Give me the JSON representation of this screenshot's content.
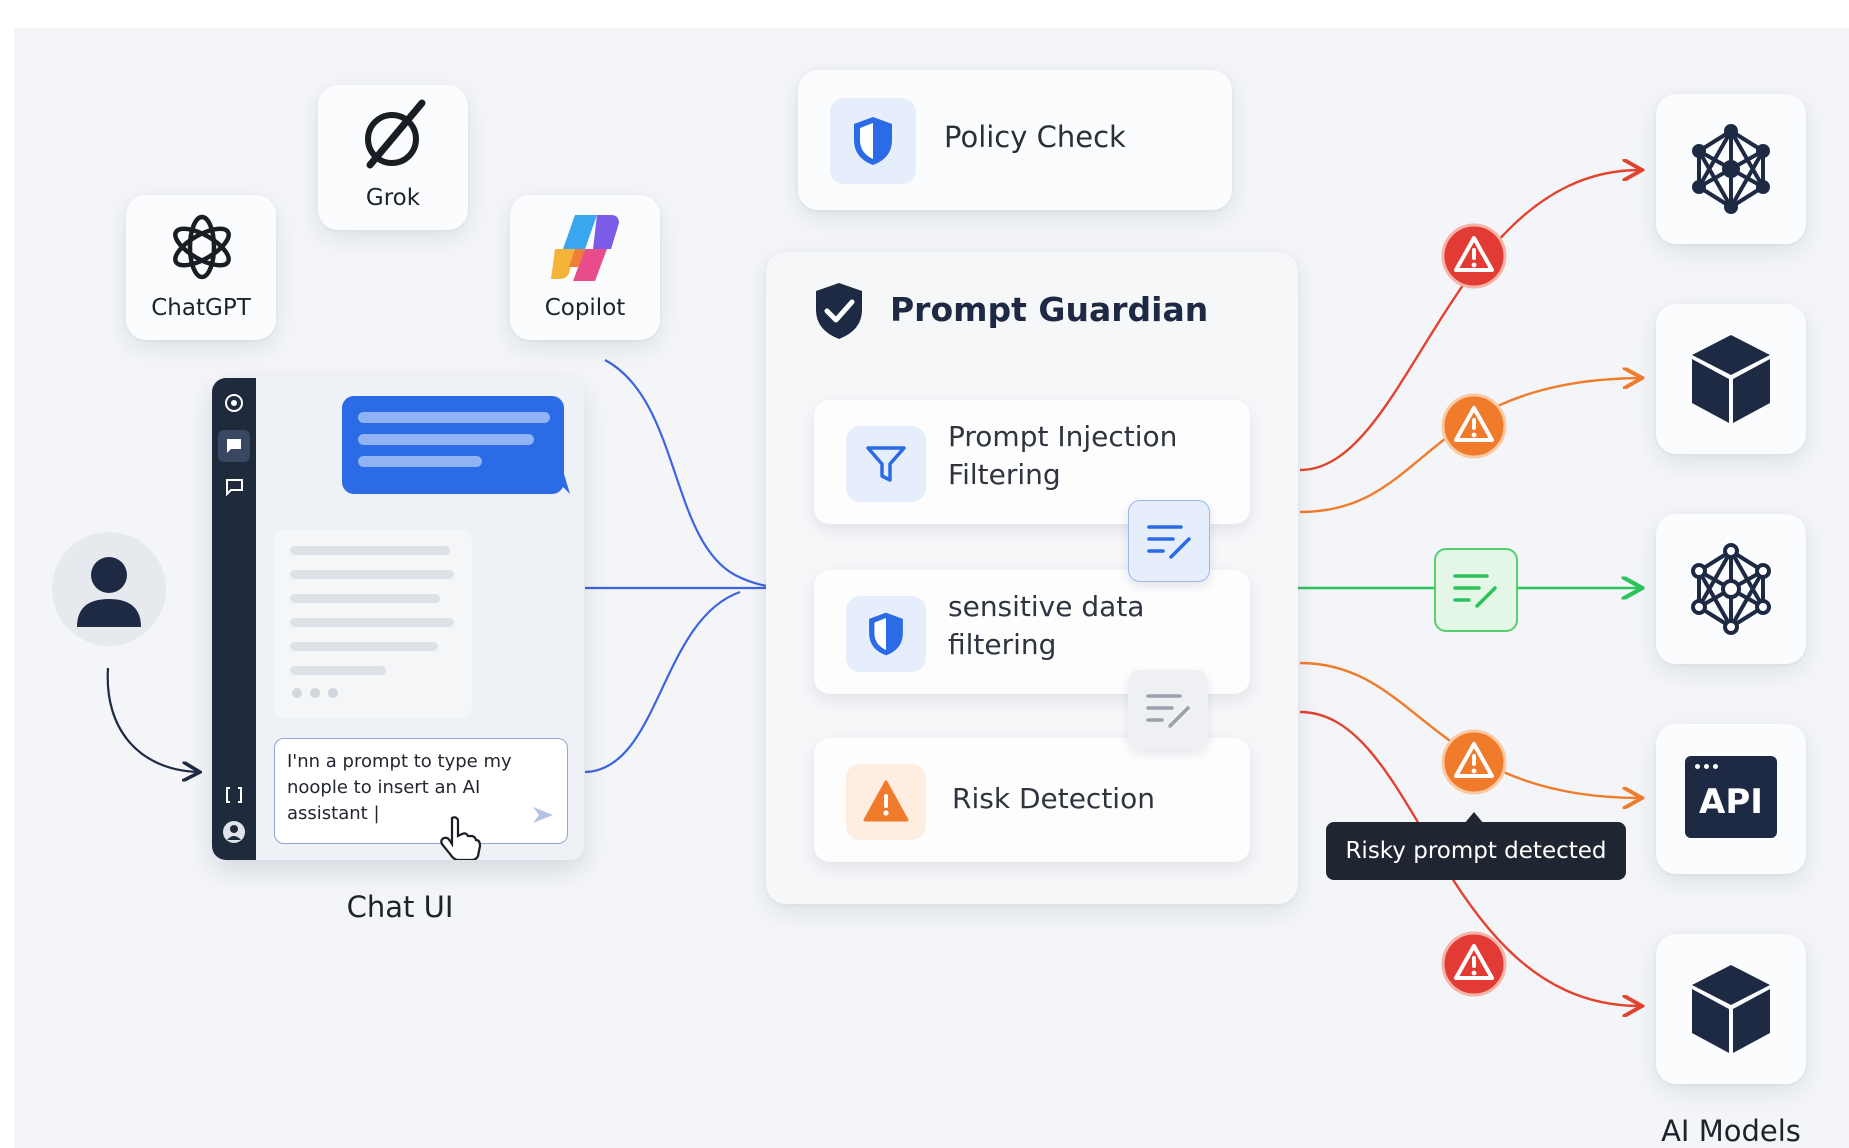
{
  "ai_apps": [
    {
      "id": "chatgpt",
      "label": "ChatGPT",
      "icon": "chatgpt-logo-icon"
    },
    {
      "id": "grok",
      "label": "Grok",
      "icon": "grok-logo-icon"
    },
    {
      "id": "copilot",
      "label": "Copilot",
      "icon": "copilot-logo-icon"
    }
  ],
  "chat_ui": {
    "label": "Chat UI",
    "input_text": "I'nn a prompt to type my noople to insert an AI assistant |",
    "sidebar_icons": [
      "settings-icon",
      "chat-icon",
      "new-chat-icon",
      "code-icon",
      "account-icon"
    ],
    "send_icon": "send-icon",
    "cursor_icon": "hand-pointer-icon"
  },
  "policy_check": {
    "label": "Policy Check",
    "icon": "shield-icon"
  },
  "guardian": {
    "title": "Prompt Guardian",
    "icon": "shield-check-icon",
    "filters": [
      {
        "line1": "Prompt Injection",
        "line2": "Filtering",
        "icon": "funnel-icon"
      },
      {
        "line1": "sensitive data",
        "line2": "filtering",
        "icon": "shield-icon"
      },
      {
        "line1": "Risk Detection",
        "line2": "",
        "icon": "warning-icon"
      }
    ]
  },
  "tooltip": {
    "text": "Risky prompt detected"
  },
  "models": {
    "label": "AI Models",
    "items": [
      {
        "icon": "neural-network-icon",
        "text": ""
      },
      {
        "icon": "cube-icon",
        "text": ""
      },
      {
        "icon": "neural-network-icon",
        "text": ""
      },
      {
        "icon": "api-icon",
        "text": "API"
      },
      {
        "icon": "cube-icon",
        "text": ""
      }
    ]
  },
  "colors": {
    "blue_flow": "#3d64e0",
    "green_flow": "#2cc45a",
    "red_flow": "#e3432e",
    "orange_flow": "#f07b2a",
    "navy": "#1e2a44",
    "accent_blue": "#2c6be6"
  }
}
